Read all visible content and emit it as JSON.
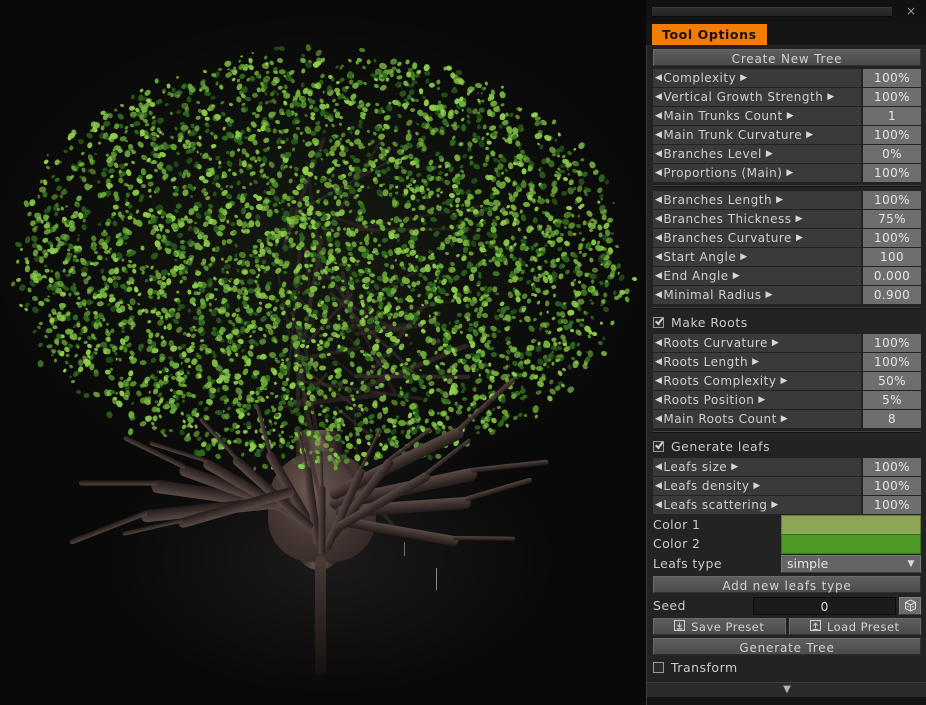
{
  "window": {
    "close_label": "×",
    "tab_label": "Tool Options",
    "tab_color": "#f27c05"
  },
  "panel": {
    "create_new_tree": "Create New Tree",
    "sections": [
      {
        "name": "trunk",
        "rows": [
          {
            "label": "Complexity",
            "value": "100%"
          },
          {
            "label": "Vertical Growth Strength",
            "value": "100%"
          },
          {
            "label": "Main Trunks Count",
            "value": "1"
          },
          {
            "label": "Main Trunk Curvature",
            "value": "100%"
          },
          {
            "label": "Branches Level",
            "value": "0%"
          },
          {
            "label": "Proportions (Main)",
            "value": "100%"
          }
        ]
      },
      {
        "name": "branches",
        "rows": [
          {
            "label": "Branches Length",
            "value": "100%"
          },
          {
            "label": "Branches Thickness",
            "value": "75%"
          },
          {
            "label": "Branches Curvature",
            "value": "100%"
          },
          {
            "label": "Start Angle",
            "value": "100"
          },
          {
            "label": "End Angle",
            "value": "0.000"
          },
          {
            "label": "Minimal Radius",
            "value": "0.900"
          }
        ]
      }
    ],
    "make_roots": {
      "label": "Make Roots",
      "checked": true
    },
    "roots_rows": [
      {
        "label": "Roots Curvature",
        "value": "100%"
      },
      {
        "label": "Roots Length",
        "value": "100%"
      },
      {
        "label": "Roots Complexity",
        "value": "50%"
      },
      {
        "label": "Roots Position",
        "value": "5%"
      },
      {
        "label": "Main Roots Count",
        "value": "8"
      }
    ],
    "generate_leafs": {
      "label": "Generate leafs",
      "checked": true
    },
    "leafs_rows": [
      {
        "label": "Leafs size",
        "value": "100%"
      },
      {
        "label": "Leafs density",
        "value": "100%"
      },
      {
        "label": "Leafs scattering",
        "value": "100%"
      }
    ],
    "color1": {
      "label": "Color 1",
      "hex": "#8ca556"
    },
    "color2": {
      "label": "Color 2",
      "hex": "#4e9a28"
    },
    "leafs_type": {
      "label": "Leafs type",
      "value": "simple",
      "chevron": "▼"
    },
    "add_new_leafs_type": "Add new leafs type",
    "seed": {
      "label": "Seed",
      "value": "0",
      "dice_icon": "dice-icon"
    },
    "save_preset": "Save Preset",
    "load_preset": "Load Preset",
    "generate_tree": "Generate Tree",
    "transform": {
      "label": "Transform",
      "checked": false
    },
    "collapse_chevron": "▼",
    "arrow_left": "◀",
    "arrow_right": "▶"
  },
  "viewport": {
    "background": "#090909",
    "leaf_color_light": "#8fce4c",
    "leaf_color_dark": "#2f6b1e",
    "bark_color": "#4a3b36"
  }
}
